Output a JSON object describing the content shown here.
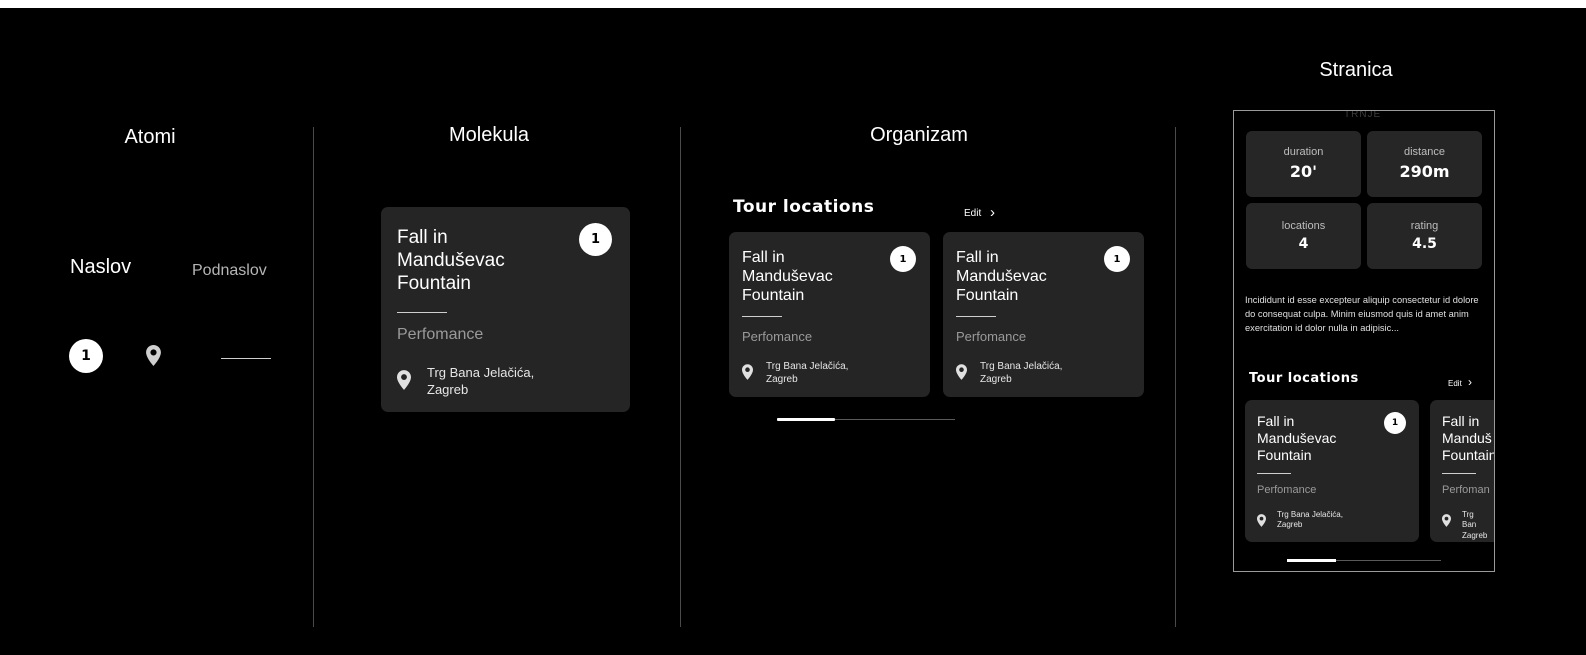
{
  "columns": {
    "atoms": "Atomi",
    "molecule": "Molekula",
    "organism": "Organizam",
    "page": "Stranica"
  },
  "atoms": {
    "title": "Naslov",
    "subtitle": "Podnaslov",
    "badge": "1",
    "icon": "location-pin-icon"
  },
  "card": {
    "title": "Fall in Manduševac Fountain",
    "subtitle": "Perfomance",
    "address": "Trg Bana Jelačića, Zagreb",
    "badge": "1"
  },
  "section": {
    "heading": "Tour locations",
    "edit": "Edit",
    "chevron": "›"
  },
  "page": {
    "map_label": "TRNJE",
    "stats": [
      {
        "label": "duration",
        "value": "20'"
      },
      {
        "label": "distance",
        "value": "290m"
      },
      {
        "label": "locations",
        "value": "4"
      },
      {
        "label": "rating",
        "value": "4.5"
      }
    ],
    "description": "Incididunt id esse excepteur aliquip consectetur id dolore do consequat culpa. Minim eiusmod quis id amet anim exercitation id dolor nulla in adipisic...",
    "truncated_card": {
      "title": "Fall in Manduš Fountain",
      "subtitle": "Perfoman",
      "address": "Trg Ban Zagreb"
    }
  },
  "colors": {
    "background": "#000000",
    "card": "#252525",
    "badge": "#ffffff"
  }
}
